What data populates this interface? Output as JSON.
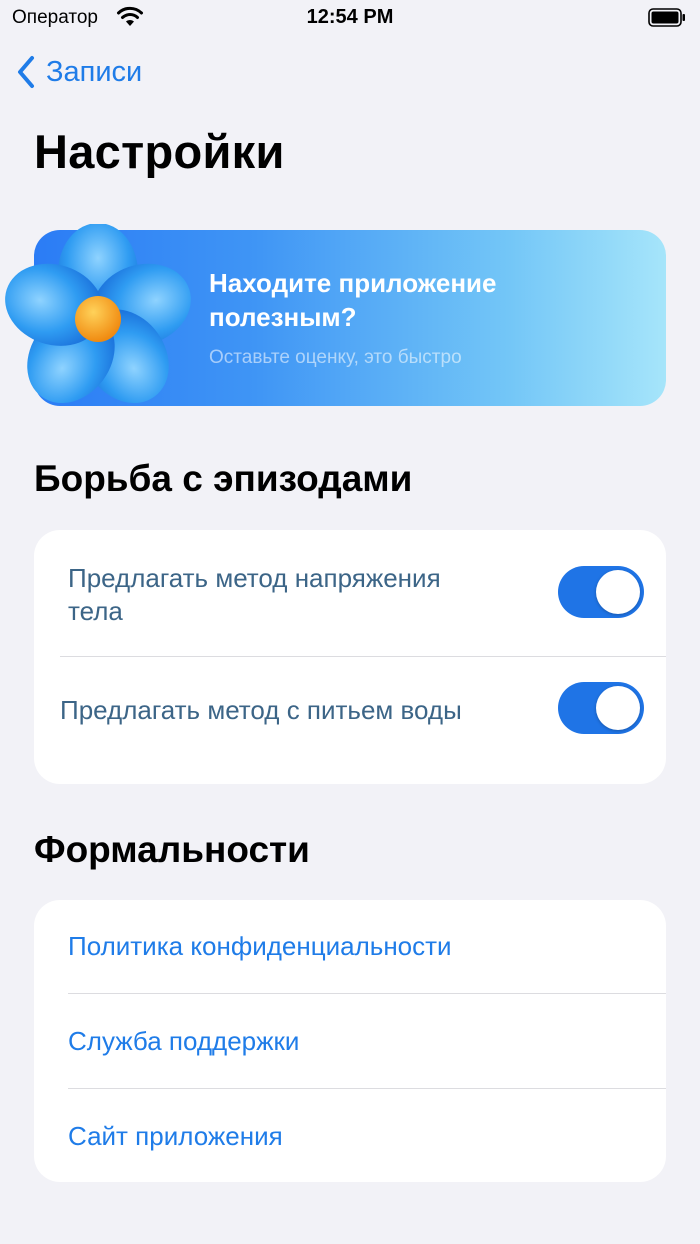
{
  "status_bar": {
    "carrier": "Оператор",
    "time": "12:54 PM"
  },
  "nav": {
    "back_label": "Записи"
  },
  "page_title": "Настройки",
  "promo": {
    "title": "Находите приложение полезным?",
    "subtitle": "Оставьте оценку, это быстро"
  },
  "sections": {
    "episodes": {
      "title": "Борьба с эпизодами",
      "rows": [
        {
          "label": "Предлагать метод напряжения тела",
          "enabled": true
        },
        {
          "label": "Предлагать метод с питьем воды",
          "enabled": true
        }
      ]
    },
    "formalities": {
      "title": "Формальности",
      "links": [
        {
          "label": "Политика конфиденциальности"
        },
        {
          "label": "Служба поддержки"
        },
        {
          "label": "Сайт приложения"
        }
      ]
    }
  },
  "colors": {
    "accent": "#1f7ce8",
    "toggle_on": "#1f74e6",
    "row_text": "#3c6587",
    "background": "#f2f2f7"
  }
}
